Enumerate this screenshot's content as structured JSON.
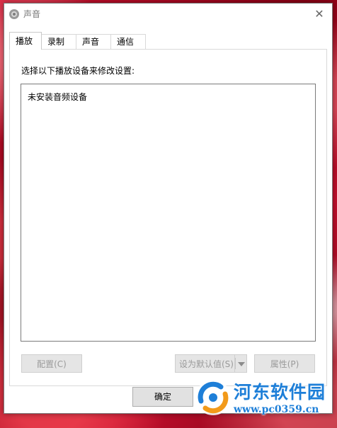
{
  "window": {
    "title": "声音",
    "icon": "speaker-icon",
    "close_icon": "close-icon"
  },
  "tabs": [
    {
      "label": "播放",
      "active": true
    },
    {
      "label": "录制",
      "active": false
    },
    {
      "label": "声音",
      "active": false
    },
    {
      "label": "通信",
      "active": false
    }
  ],
  "playback": {
    "instruction": "选择以下播放设备来修改设置:",
    "empty_message": "未安装音频设备"
  },
  "buttons": {
    "configure": "配置(C)",
    "set_default": "设为默认值(S)",
    "properties": "属性(P)",
    "ok": "确定"
  },
  "watermark": {
    "site_name": "河东软件园",
    "url": "www.pc0359.cn",
    "color": "#1e7fd8"
  }
}
